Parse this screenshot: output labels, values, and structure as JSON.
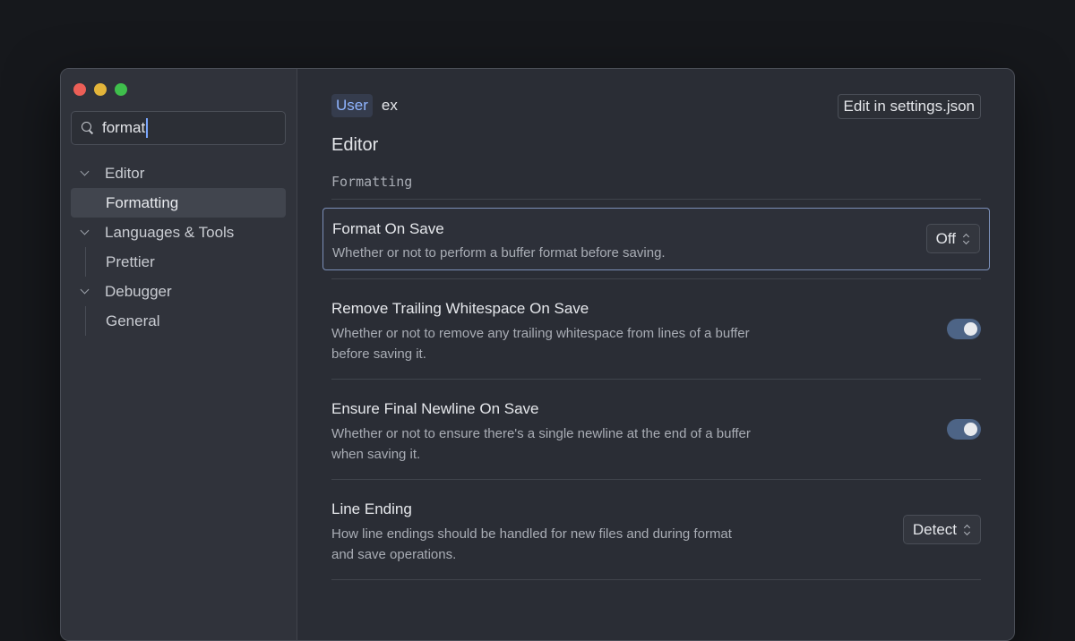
{
  "window": {
    "traffic_lights": [
      "close",
      "minimize",
      "zoom"
    ]
  },
  "sidebar": {
    "search": {
      "value": "format",
      "icon": "search-icon"
    },
    "tree": [
      {
        "label": "Editor",
        "type": "parent",
        "expanded": true
      },
      {
        "label": "Formatting",
        "type": "child",
        "selected": true
      },
      {
        "label": "Languages & Tools",
        "type": "parent",
        "expanded": true
      },
      {
        "label": "Prettier",
        "type": "child",
        "selected": false
      },
      {
        "label": "Debugger",
        "type": "parent",
        "expanded": true
      },
      {
        "label": "General",
        "type": "child",
        "selected": false
      }
    ]
  },
  "header": {
    "tabs": [
      "User",
      "ex"
    ],
    "edit_button": "Edit in settings.json"
  },
  "section": {
    "title": "Editor",
    "subtitle": "Formatting"
  },
  "settings": [
    {
      "title": "Format On Save",
      "description": "Whether or not to perform a buffer format before saving.",
      "control": "select",
      "value": "Off"
    },
    {
      "title": "Remove Trailing Whitespace On Save",
      "description": "Whether or not to remove any trailing whitespace from lines of a buffer before saving it.",
      "control": "toggle",
      "value": "on"
    },
    {
      "title": "Ensure Final Newline On Save",
      "description": "Whether or not to ensure there's a single newline at the end of a buffer when saving it.",
      "control": "toggle",
      "value": "on"
    },
    {
      "title": "Line Ending",
      "description": "How line endings should be handled for new files and during format and save operations.",
      "control": "select",
      "value": "Detect"
    }
  ],
  "colors": {
    "accent": "#8fb4ff",
    "toggle_on": "#4d6486",
    "focus_border": "#7b8fb8"
  }
}
